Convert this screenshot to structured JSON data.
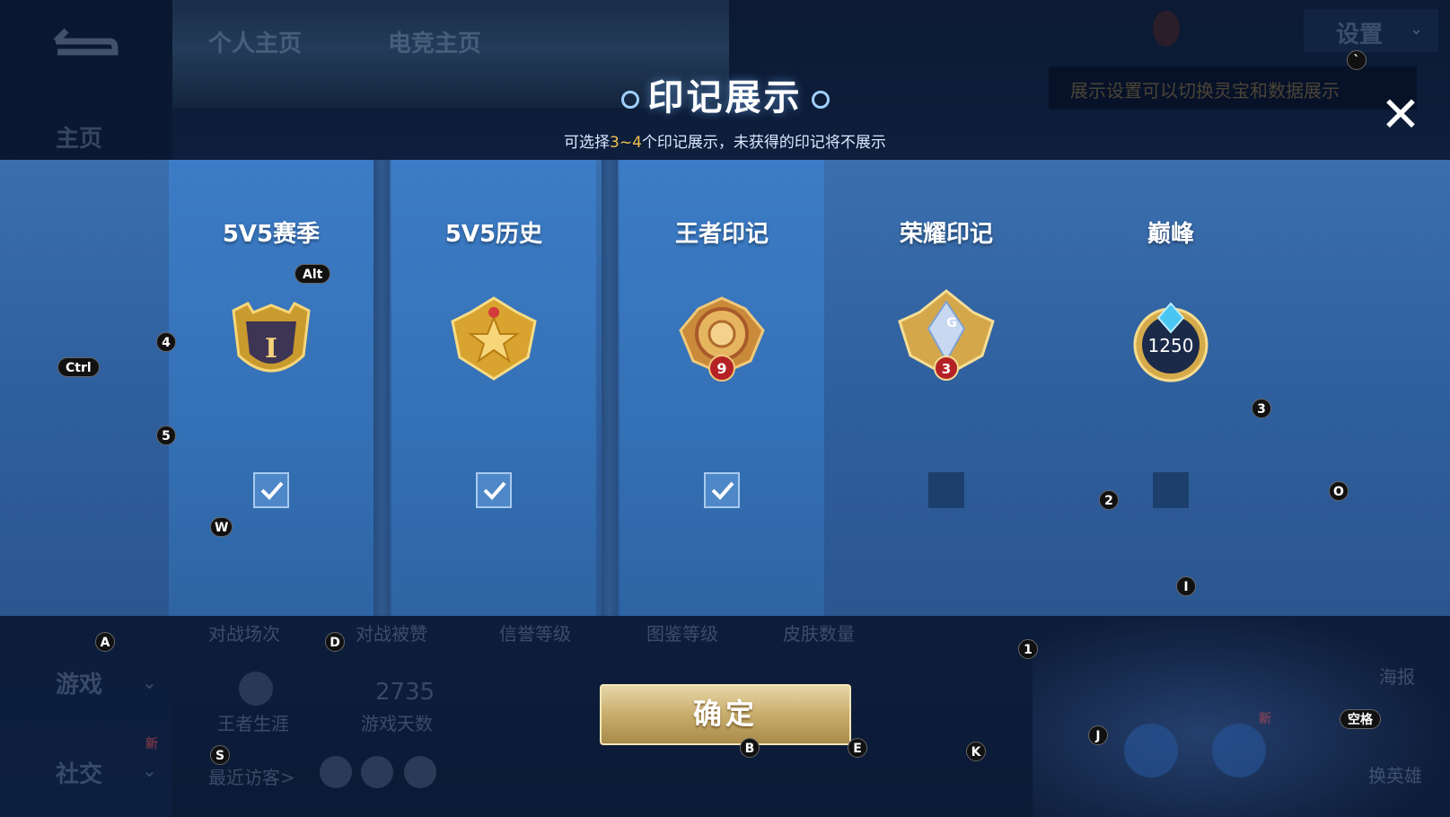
{
  "background": {
    "back_icon": "back-arrow-icon",
    "tabs": [
      "个人主页",
      "电竞主页"
    ],
    "home_label": "主页",
    "settings_label": "设置",
    "settings_hint": "展示设置可以切换灵宝和数据展示",
    "nav_game": "游戏",
    "nav_social": "社交",
    "new_badge": "新",
    "stats_headers": [
      "对战场次",
      "对战被赞",
      "信誉等级",
      "图鉴等级",
      "皮肤数量"
    ],
    "career_label": "王者生涯",
    "days_value": "2735",
    "days_label": "游戏天数",
    "recent_visitors": "最近访客>",
    "poster_label": "海报",
    "switch_hero_label": "换英雄"
  },
  "dialog": {
    "title": "印记展示",
    "subtitle_prefix": "可选择",
    "subtitle_highlight": "3~4",
    "subtitle_suffix": "个印记展示，未获得的印记将不展示",
    "close_icon": "close-icon",
    "columns": [
      {
        "title": "5V5赛季",
        "badge": "season-shield-badge",
        "badge_text": "I",
        "checked": true
      },
      {
        "title": "5V5历史",
        "badge": "history-star-badge",
        "badge_text": "",
        "checked": true
      },
      {
        "title": "王者印记",
        "badge": "king-mark-badge",
        "badge_text": "9",
        "checked": true
      },
      {
        "title": "荣耀印记",
        "badge": "glory-mark-badge",
        "badge_text": "3",
        "checked": false
      },
      {
        "title": "巅峰",
        "badge": "peak-badge",
        "badge_text": "1250",
        "checked": false
      }
    ],
    "glory_letter": "G",
    "confirm_label": "确定"
  },
  "key_hints": {
    "alt": "Alt",
    "ctrl": "Ctrl",
    "k4": "4",
    "k5": "5",
    "w": "W",
    "k3": "3",
    "k2": "2",
    "o": "O",
    "i": "I",
    "a": "A",
    "d": "D",
    "k1": "1",
    "s": "S",
    "b": "B",
    "e": "E",
    "k": "K",
    "j": "J",
    "space": "空格",
    "backtick": "`"
  },
  "colors": {
    "accent_gold": "#f2c14e",
    "panel_blue": "#3470b5"
  }
}
